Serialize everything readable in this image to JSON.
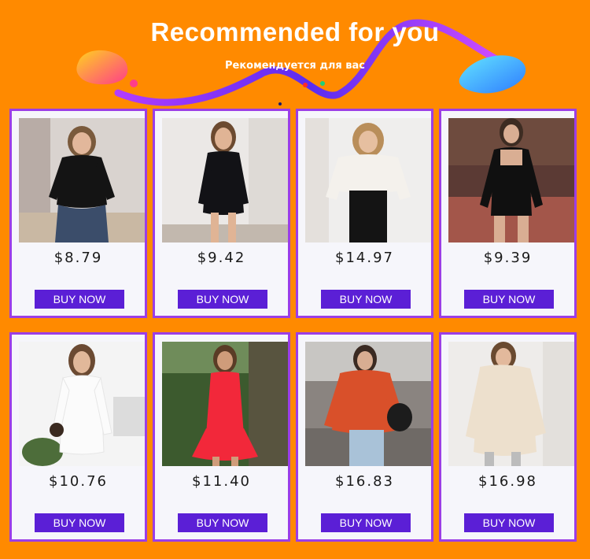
{
  "header": {
    "title": "Recommended for you",
    "subtitle": "Рекомендуется для вас"
  },
  "colors": {
    "background": "#ff8a00",
    "card_border": "#9b3ee6",
    "button": "#5b1fd6",
    "card_bg": "#f6f6fb"
  },
  "products": [
    {
      "price": "$8.79",
      "button": "BUY NOW",
      "image": "woman-black-bodysuit-jeans"
    },
    {
      "price": "$9.42",
      "button": "BUY NOW",
      "image": "woman-black-mini-dress"
    },
    {
      "price": "$14.97",
      "button": "BUY NOW",
      "image": "woman-white-knit-crop-sweater"
    },
    {
      "price": "$9.39",
      "button": "BUY NOW",
      "image": "woman-black-square-neck-bodysuit"
    },
    {
      "price": "$10.76",
      "button": "BUY NOW",
      "image": "woman-white-vneck-dress"
    },
    {
      "price": "$11.40",
      "button": "BUY NOW",
      "image": "woman-red-ruffle-slip-dress"
    },
    {
      "price": "$16.83",
      "button": "BUY NOW",
      "image": "woman-orange-turtleneck-sweater"
    },
    {
      "price": "$16.98",
      "button": "BUY NOW",
      "image": "woman-beige-sweater-dress"
    }
  ]
}
